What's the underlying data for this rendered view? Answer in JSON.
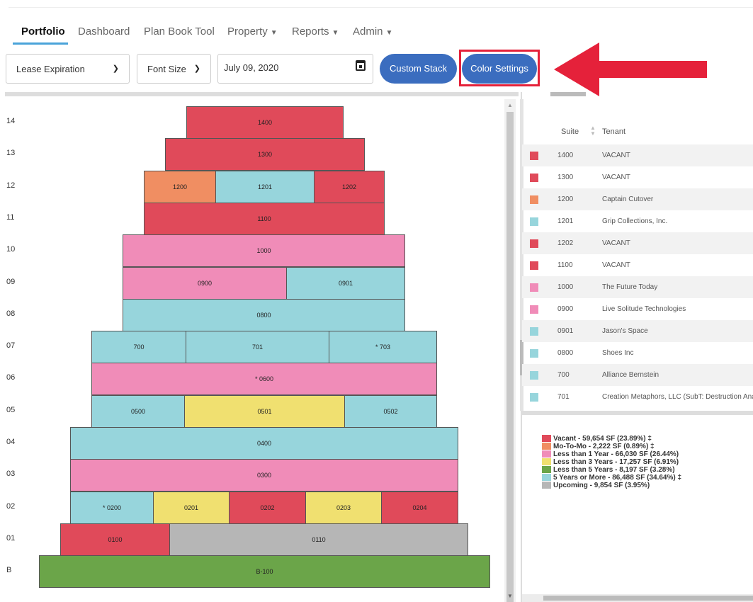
{
  "nav": {
    "items": [
      {
        "label": "Portfolio",
        "active": true,
        "dropdown": false
      },
      {
        "label": "Dashboard",
        "active": false,
        "dropdown": false
      },
      {
        "label": "Plan Book Tool",
        "active": false,
        "dropdown": false
      },
      {
        "label": "Property",
        "active": false,
        "dropdown": true
      },
      {
        "label": "Reports",
        "active": false,
        "dropdown": true
      },
      {
        "label": "Admin",
        "active": false,
        "dropdown": true
      }
    ]
  },
  "toolbar": {
    "view_select": "Lease Expiration",
    "font_size_select": "Font Size",
    "date_value": "July 09, 2020",
    "custom_stack_label": "Custom Stack",
    "color_settings_label": "Color Settings",
    "button_color": "#3b6dbf",
    "highlight_color": "#e5213a"
  },
  "stack": {
    "floors": [
      {
        "label": "14",
        "suites": [
          {
            "id": "1400",
            "category": "vacant"
          }
        ]
      },
      {
        "label": "13",
        "suites": [
          {
            "id": "1300",
            "category": "vacant"
          }
        ]
      },
      {
        "label": "12",
        "suites": [
          {
            "id": "1200",
            "category": "mo-to-mo"
          },
          {
            "id": "1201",
            "category": "5-years-plus"
          },
          {
            "id": "1202",
            "category": "vacant"
          }
        ]
      },
      {
        "label": "11",
        "suites": [
          {
            "id": "1100",
            "category": "vacant"
          }
        ]
      },
      {
        "label": "10",
        "suites": [
          {
            "id": "1000",
            "category": "lt-1-year"
          }
        ]
      },
      {
        "label": "09",
        "suites": [
          {
            "id": "0900",
            "category": "lt-1-year"
          },
          {
            "id": "0901",
            "category": "5-years-plus"
          }
        ]
      },
      {
        "label": "08",
        "suites": [
          {
            "id": "0800",
            "category": "5-years-plus"
          }
        ]
      },
      {
        "label": "07",
        "suites": [
          {
            "id": "700",
            "category": "5-years-plus"
          },
          {
            "id": "701",
            "category": "5-years-plus"
          },
          {
            "id": "* 703",
            "category": "5-years-plus"
          }
        ]
      },
      {
        "label": "06",
        "suites": [
          {
            "id": "* 0600",
            "category": "lt-1-year"
          }
        ]
      },
      {
        "label": "05",
        "suites": [
          {
            "id": "0500",
            "category": "5-years-plus"
          },
          {
            "id": "0501",
            "category": "lt-3-years"
          },
          {
            "id": "0502",
            "category": "5-years-plus"
          }
        ]
      },
      {
        "label": "04",
        "suites": [
          {
            "id": "0400",
            "category": "5-years-plus"
          }
        ]
      },
      {
        "label": "03",
        "suites": [
          {
            "id": "0300",
            "category": "lt-1-year"
          }
        ]
      },
      {
        "label": "02",
        "suites": [
          {
            "id": "* 0200",
            "category": "5-years-plus"
          },
          {
            "id": "0201",
            "category": "lt-3-years"
          },
          {
            "id": "0202",
            "category": "vacant"
          },
          {
            "id": "0203",
            "category": "lt-3-years"
          },
          {
            "id": "0204",
            "category": "vacant"
          }
        ]
      },
      {
        "label": "01",
        "suites": [
          {
            "id": "0100",
            "category": "vacant"
          },
          {
            "id": "0110",
            "category": "upcoming"
          }
        ]
      },
      {
        "label": "B",
        "suites": [
          {
            "id": "B-100",
            "category": "lt-5-years"
          }
        ]
      }
    ]
  },
  "table": {
    "headers": {
      "suite": "Suite",
      "tenant": "Tenant"
    },
    "rows": [
      {
        "suite": "1400",
        "tenant": "VACANT",
        "category": "vacant"
      },
      {
        "suite": "1300",
        "tenant": "VACANT",
        "category": "vacant"
      },
      {
        "suite": "1200",
        "tenant": "Captain Cutover",
        "category": "mo-to-mo"
      },
      {
        "suite": "1201",
        "tenant": "Grip Collections, Inc.",
        "category": "5-years-plus"
      },
      {
        "suite": "1202",
        "tenant": "VACANT",
        "category": "vacant"
      },
      {
        "suite": "1100",
        "tenant": "VACANT",
        "category": "vacant"
      },
      {
        "suite": "1000",
        "tenant": "The Future Today",
        "category": "lt-1-year"
      },
      {
        "suite": "0900",
        "tenant": "Live Solitude Technologies",
        "category": "lt-1-year"
      },
      {
        "suite": "0901",
        "tenant": "Jason's Space",
        "category": "5-years-plus"
      },
      {
        "suite": "0800",
        "tenant": "Shoes Inc",
        "category": "5-years-plus"
      },
      {
        "suite": "700",
        "tenant": "Alliance Bernstein",
        "category": "5-years-plus"
      },
      {
        "suite": "701",
        "tenant": "Creation Metaphors, LLC (SubT: Destruction Analc",
        "category": "5-years-plus"
      }
    ]
  },
  "legend": [
    {
      "label": "Vacant - 59,654 SF (23.89%) ‡",
      "category": "vacant"
    },
    {
      "label": "Mo-To-Mo - 2,222 SF (0.89%) ‡",
      "category": "mo-to-mo"
    },
    {
      "label": "Less than 1 Year - 66,030 SF (26.44%)",
      "category": "lt-1-year"
    },
    {
      "label": "Less than 3 Years - 17,257 SF (6.91%)",
      "category": "lt-3-years"
    },
    {
      "label": "Less than 5 Years - 8,197 SF (3.28%)",
      "category": "lt-5-years"
    },
    {
      "label": "5 Years or More - 86,488 SF (34.64%) ‡",
      "category": "5-years-plus"
    },
    {
      "label": "Upcoming - 9,854 SF (3.95%)",
      "category": "upcoming"
    }
  ],
  "category_colors": {
    "vacant": "#e04a5a",
    "mo-to-mo": "#f08e62",
    "lt-1-year": "#f08cb8",
    "lt-3-years": "#f0e070",
    "lt-5-years": "#6ba549",
    "5-years-plus": "#97d5dc",
    "upcoming": "#b6b6b6"
  }
}
